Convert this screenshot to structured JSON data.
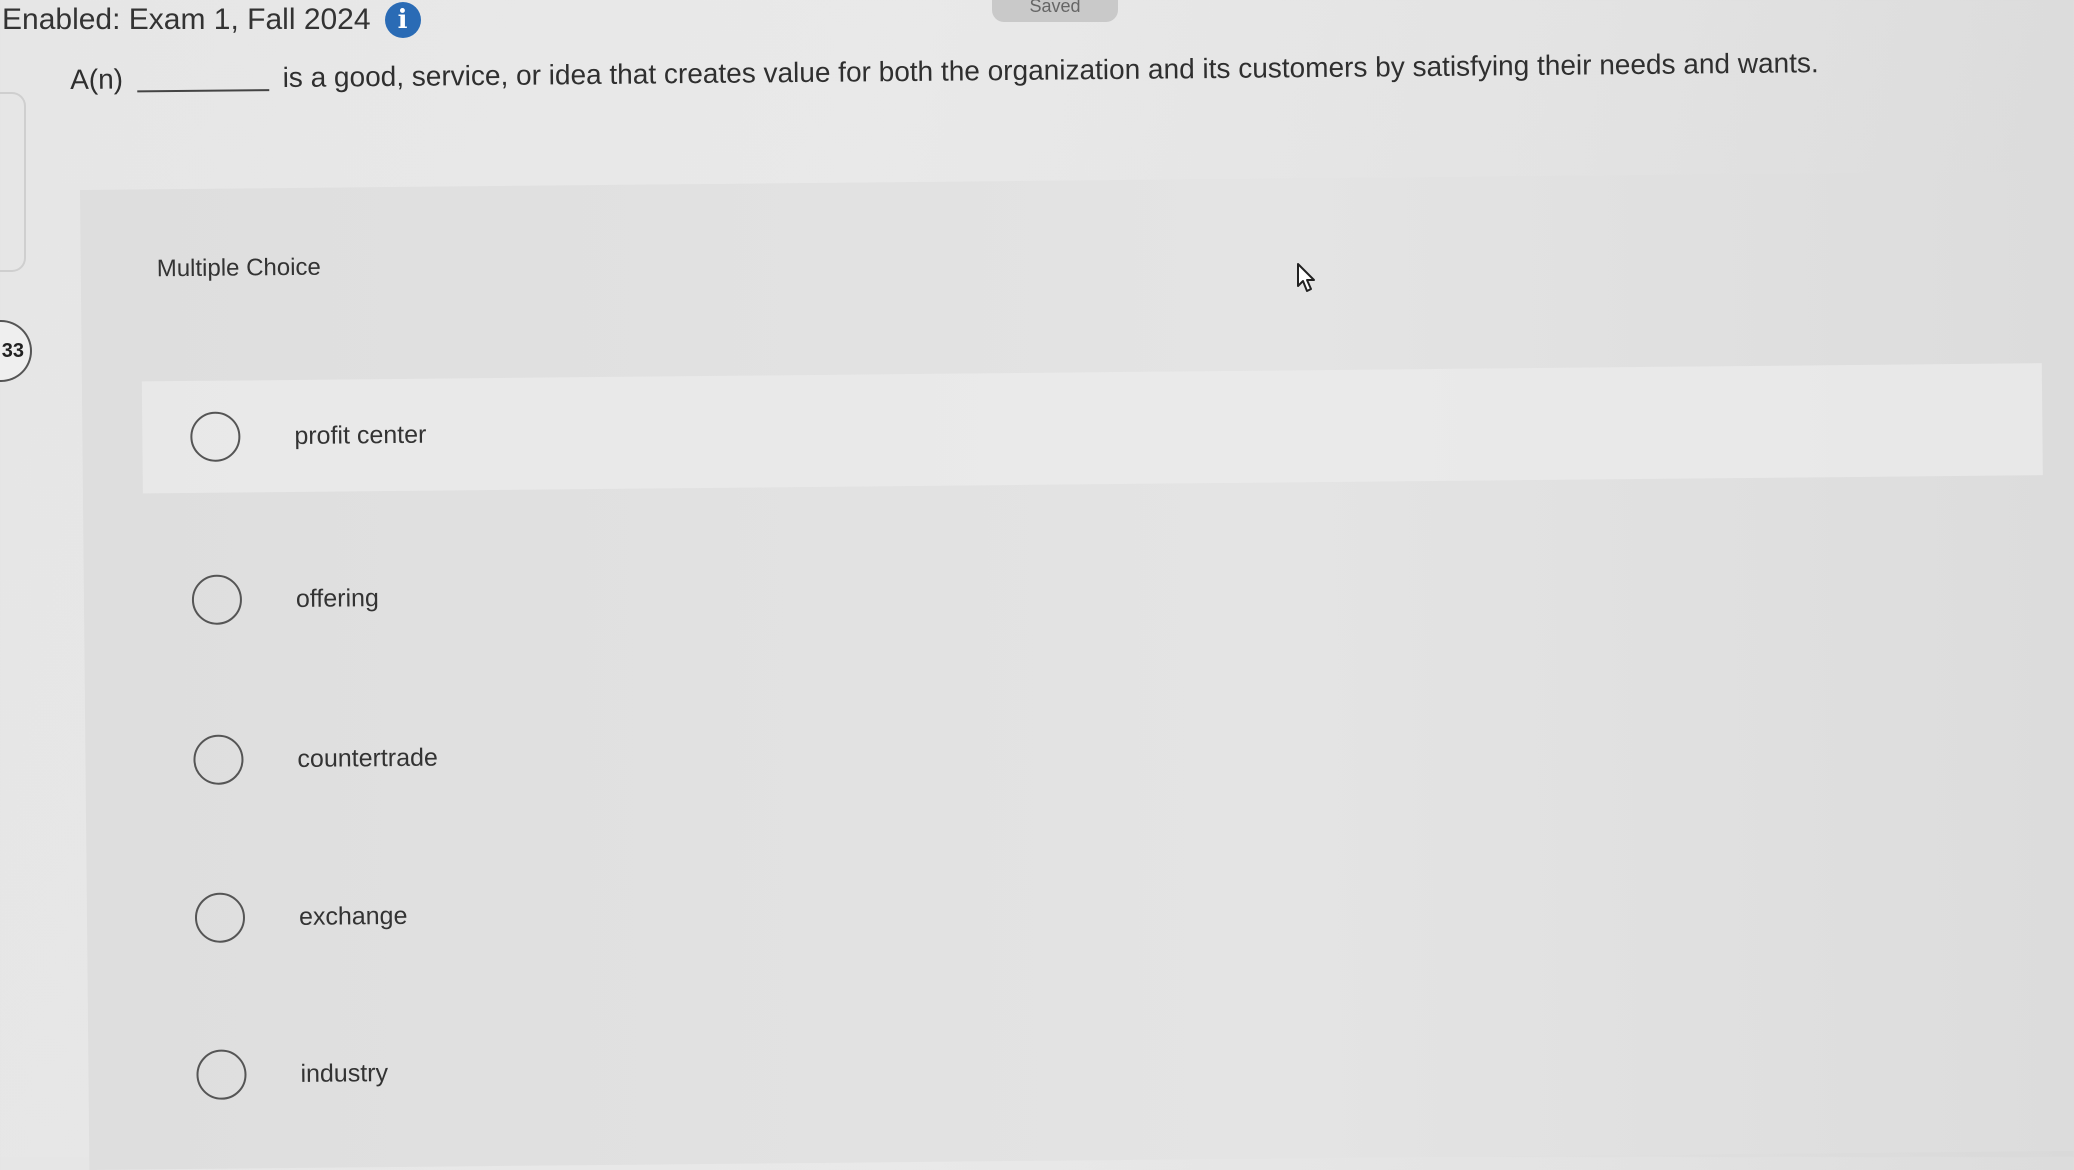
{
  "header": {
    "assignment_title": "Enabled: Exam 1, Fall 2024",
    "info_icon": "info-icon",
    "saved_label": "Saved"
  },
  "question": {
    "number": "33",
    "prompt_before_blank": "A(n)",
    "prompt_after_blank": "is a good, service, or idea that creates value for both the organization and its customers by satisfying their needs and wants.",
    "type_label": "Multiple Choice",
    "choices": [
      {
        "label": "profit center"
      },
      {
        "label": "offering"
      },
      {
        "label": "countertrade"
      },
      {
        "label": "exchange"
      },
      {
        "label": "industry"
      }
    ]
  },
  "colors": {
    "info_accent": "#2a6bb5",
    "page_background": "#e6e6e6"
  }
}
